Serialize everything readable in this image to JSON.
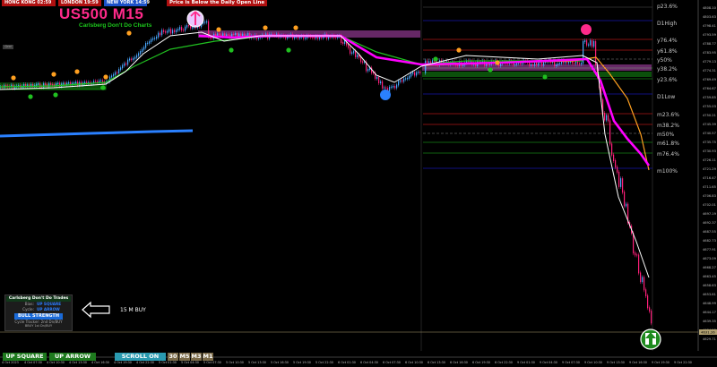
{
  "sessions": {
    "hong_kong": "HONG KONG 02:59",
    "london": "LONDON  19:59",
    "new_york": "NEW YORK  14:59"
  },
  "status_message": "Price is Below the Daily Open Line",
  "symbol_title": "US500 M15",
  "subtitle": "Carlsberg Don't Do Charts",
  "mini_button": "Grid",
  "fib_levels": {
    "p23": "p23.6%",
    "d1high": "D1High",
    "y76": "y76.4%",
    "y61": "y61.8%",
    "y50": "y50%",
    "y38": "y38.2%",
    "y23": "y23.6%",
    "d1low": "D1Low",
    "m23": "m23.6%",
    "m38": "m38.2%",
    "m50": "m50%",
    "m61": "m61.8%",
    "m76": "m76.4%",
    "m100": "m100%"
  },
  "price_axis": {
    "ticks": [
      "4808.10",
      "4803.63",
      "4798.41",
      "4793.59",
      "4788.77",
      "4783.95",
      "4779.13",
      "4774.31",
      "4769.49",
      "4764.67",
      "4759.85",
      "4755.03",
      "4750.21",
      "4745.39",
      "4740.57",
      "4735.75",
      "4730.93",
      "4726.11",
      "4721.29",
      "4716.47",
      "4711.65",
      "4706.83",
      "4702.01",
      "4697.19",
      "4692.37",
      "4687.55",
      "4682.73",
      "4677.91",
      "4673.09",
      "4668.27",
      "4663.45",
      "4658.63",
      "4653.81",
      "4648.99",
      "4644.17",
      "4639.35",
      "4634.53",
      "4629.71"
    ],
    "current_price": "4631.26"
  },
  "time_axis": {
    "ticks": [
      "4 Oct 2023",
      "4 Oct 07:30",
      "4 Oct 10:30",
      "4 Oct 13:30",
      "4 Oct 16:30",
      "4 Oct 19:30",
      "4 Oct 22:30",
      "5 Oct 01:30",
      "5 Oct 04:30",
      "5 Oct 07:30",
      "5 Oct 10:30",
      "5 Oct 13:30",
      "5 Oct 16:30",
      "5 Oct 19:30",
      "5 Oct 22:30",
      "6 Oct 01:30",
      "6 Oct 04:30",
      "6 Oct 07:30",
      "6 Oct 10:30",
      "6 Oct 13:30",
      "6 Oct 16:30",
      "6 Oct 19:30",
      "6 Oct 22:30",
      "9 Oct 01:30",
      "9 Oct 04:30",
      "9 Oct 07:30",
      "9 Oct 10:30",
      "9 Oct 13:30",
      "9 Oct 16:30",
      "9 Oct 19:30",
      "9 Oct 22:30"
    ]
  },
  "panel": {
    "title": "Carlsberg Don't Do Trades",
    "bias_label": "Bias:",
    "bias_value": "UP SQUARE",
    "cycle_label": "Cycle:",
    "cycle_value": "UP ARROW",
    "strength": "BULL STRENGTH",
    "footer1": "Cycle Tracker: 2nd Dn/BUY",
    "footer2": "BBUY  1st  Dn/BUY"
  },
  "buy_signal_label": "15 M BUY",
  "bottom_buttons": {
    "up_square": "UP SQUARE",
    "up_arrow": "UP ARROW",
    "scroll": "SCROLL ON",
    "tf_30": "30",
    "tf_m5": "M5",
    "tf_m3": "M3",
    "tf_m1": "M1"
  },
  "colors": {
    "background": "#000000",
    "bull_candle": "#4aa8ff",
    "bear_candle": "#ff1f7a",
    "ma_fast": "#ffffff",
    "ma_mid": "#ff00ff",
    "ma_slow": "#20c020",
    "ma_orange": "#ffa020",
    "trend_line": "#2a80ff",
    "session_box_green": "#1cc81c",
    "session_box_magenta": "#ff66ff"
  }
}
